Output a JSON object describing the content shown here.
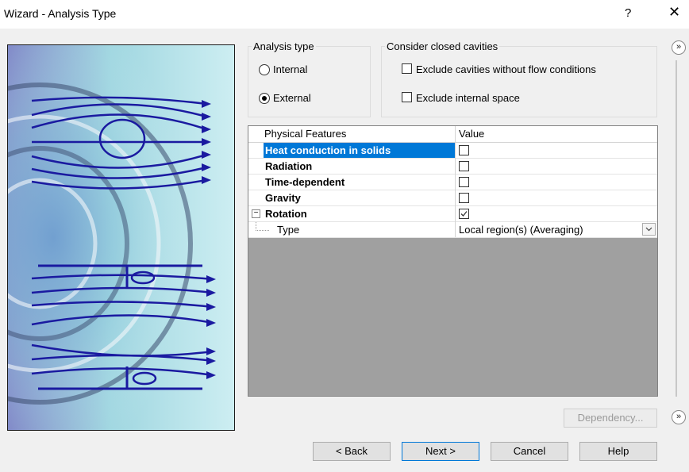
{
  "window": {
    "title": "Wizard - Analysis Type",
    "help": "?",
    "close": "✕"
  },
  "analysis_type": {
    "label": "Analysis type",
    "options": [
      {
        "label": "Internal",
        "checked": false
      },
      {
        "label": "External",
        "checked": true
      }
    ]
  },
  "closed_cavities": {
    "label": "Consider closed cavities",
    "options": [
      {
        "label": "Exclude cavities without flow conditions",
        "checked": false
      },
      {
        "label": "Exclude internal space",
        "checked": false
      }
    ]
  },
  "grid": {
    "headers": {
      "name": "Physical Features",
      "value": "Value"
    },
    "rows": [
      {
        "name": "Heat conduction in solids",
        "checked": false,
        "selected": true
      },
      {
        "name": "Radiation",
        "checked": false
      },
      {
        "name": "Time-dependent",
        "checked": false
      },
      {
        "name": "Gravity",
        "checked": false
      },
      {
        "name": "Rotation",
        "checked": true,
        "expander": "−"
      },
      {
        "name": "Type",
        "value": "Local region(s) (Averaging)"
      }
    ]
  },
  "buttons": {
    "dependency": "Dependency...",
    "back": "< Back",
    "next": "Next >",
    "cancel": "Cancel",
    "help": "Help"
  },
  "expand_icon": "»",
  "colors": {
    "selection": "#0078d7",
    "flow_lines": "#1a1aa0"
  }
}
